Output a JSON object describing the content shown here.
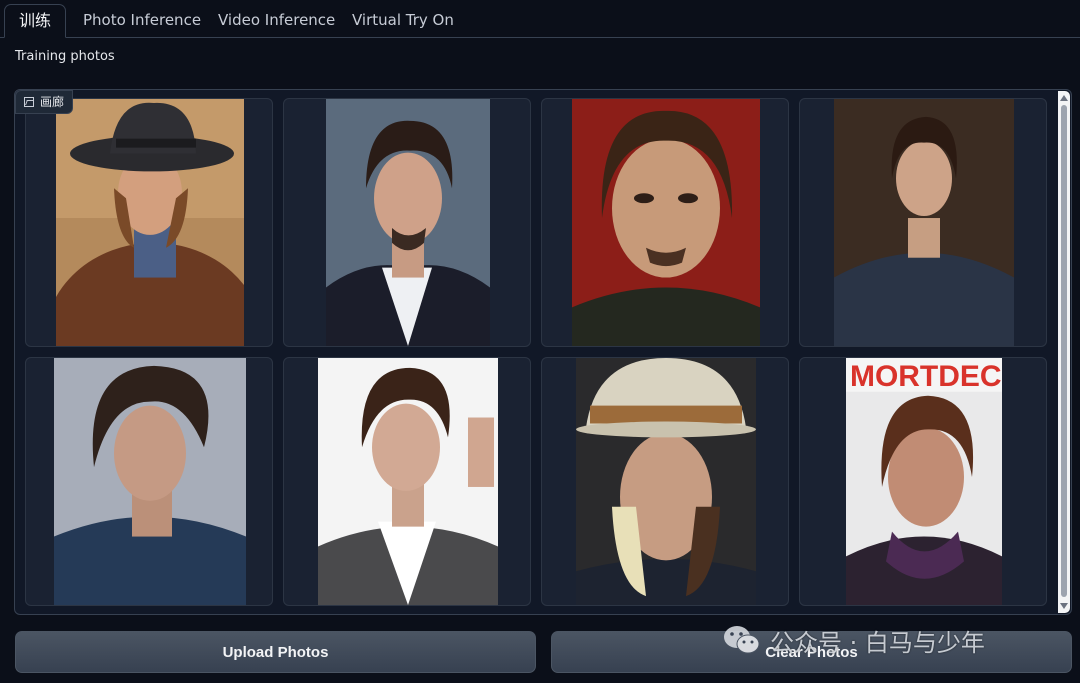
{
  "tabs": [
    {
      "label": "训练",
      "active": true
    },
    {
      "label": "Photo Inference",
      "active": false
    },
    {
      "label": "Video Inference",
      "active": false
    },
    {
      "label": "Virtual Try On",
      "active": false
    }
  ],
  "section_label": "Training photos",
  "gallery": {
    "badge": "画廊",
    "badge_icon": "image-icon"
  },
  "buttons": {
    "upload": "Upload Photos",
    "clear": "Clear Photos"
  },
  "watermark": {
    "icon": "wechat-icon",
    "text": "公众号 · 白马与少年"
  },
  "colors": {
    "background": "#0b0f19",
    "panel": "#111827",
    "button": "#374151"
  }
}
